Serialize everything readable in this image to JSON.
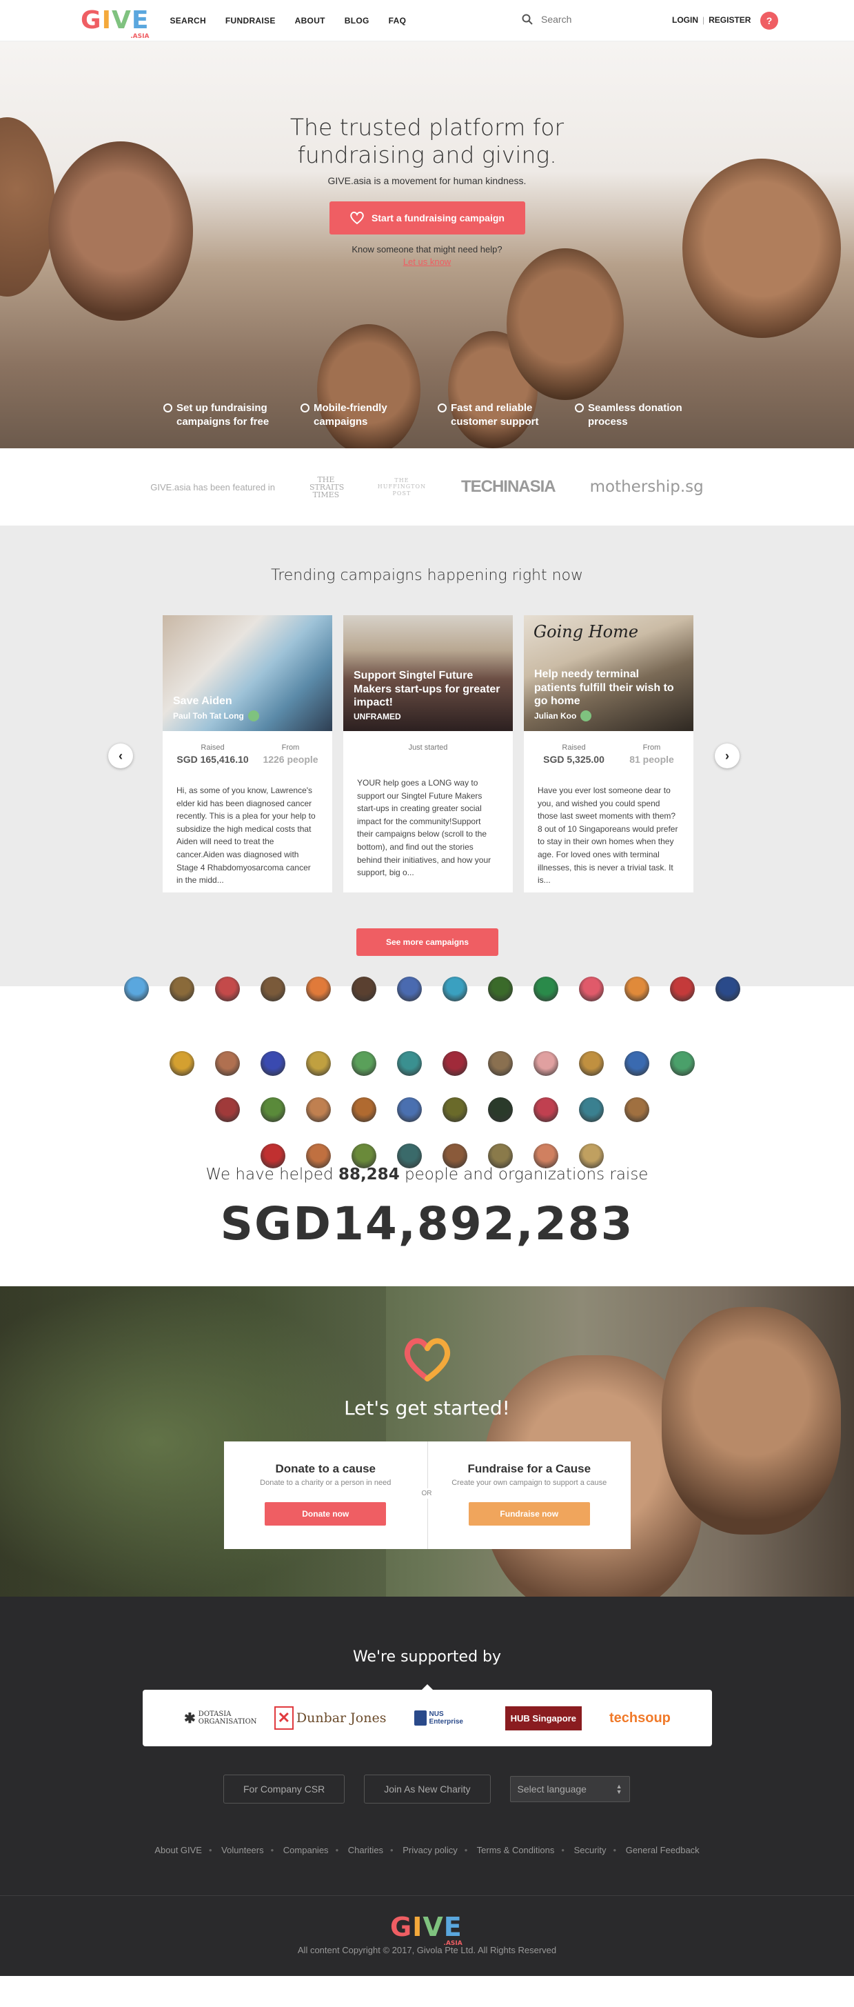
{
  "header": {
    "logo": {
      "g": "G",
      "i": "I",
      "v": "V",
      "e": "E",
      "asia": ".ASIA"
    },
    "nav": [
      "SEARCH",
      "FUNDRAISE",
      "ABOUT",
      "BLOG",
      "FAQ"
    ],
    "search_placeholder": "Search",
    "login": "LOGIN",
    "sep": "|",
    "register": "REGISTER",
    "help": "?"
  },
  "hero": {
    "title_line1": "The trusted platform for",
    "title_line2": "fundraising and giving.",
    "subtitle": "GIVE.asia is a movement for human kindness.",
    "cta": "Start a fundraising campaign",
    "know": "Know someone that might need help?",
    "letus": "Let us know",
    "features": [
      {
        "line1": "Set up fundraising",
        "line2": "campaigns for free"
      },
      {
        "line1": "Mobile-friendly",
        "line2": "campaigns"
      },
      {
        "line1": "Fast and reliable",
        "line2": "customer support"
      },
      {
        "line1": "Seamless donation",
        "line2": "process"
      }
    ]
  },
  "press": {
    "featured": "GIVE.asia has been featured in",
    "straits": "THE STRAITS TIMES",
    "huffington": "THE HUFFINGTON POST",
    "techinasia": "TECHINASIA",
    "mothership": "mothership.sg"
  },
  "trending": {
    "title": "Trending campaigns happening right now",
    "cards": [
      {
        "title": "Save Aiden",
        "owner": "Paul Toh Tat Long",
        "raised_label": "Raised",
        "raised": "SGD 165,416.10",
        "from_label": "From",
        "from": "1226 people",
        "desc": "Hi, as some of you know, Lawrence's elder kid has been diagnosed cancer recently.  This is a plea for your help to subsidize the high medical costs that Aiden will need to treat the cancer.Aiden was diagnosed with Stage 4 Rhabdomyosarcoma cancer in the midd..."
      },
      {
        "title": "Support Singtel Future Makers start-ups for greater impact!",
        "owner": "UNFRAMED",
        "status": "Just started",
        "desc": "YOUR help goes a LONG way to support our Singtel Future Makers start-ups in creating greater social impact for the community!Support their campaigns below (scroll to the bottom), and find out the stories behind their initiatives, and how your support, big o..."
      },
      {
        "title": "Help needy terminal patients fulfill their wish to go home",
        "owner": "Julian Koo",
        "raised_label": "Raised",
        "raised": "SGD 5,325.00",
        "from_label": "From",
        "from": "81 people",
        "desc": "Have you ever lost someone dear to you, and wished you could spend those last sweet moments with them? 8 out of 10 Singaporeans would prefer to stay in their own homes when they age. For loved ones with terminal illnesses, this is never a trivial task. It is..."
      }
    ],
    "going_home": "Going Home",
    "prev": "‹",
    "next": "›",
    "more": "See more campaigns"
  },
  "helped": {
    "pre": "We have helped ",
    "count": "88,284",
    "post": " people and organizations raise",
    "amount": "SGD14,892,283"
  },
  "started": {
    "title": "Let's get started!",
    "donate_title": "Donate to a cause",
    "donate_sub": "Donate to a charity or a person in need",
    "donate_btn": "Donate now",
    "or": "OR",
    "fund_title": "Fundraise for a Cause",
    "fund_sub": "Create your own campaign to support a cause",
    "fund_btn": "Fundraise now"
  },
  "footer": {
    "supported_title": "We're supported by",
    "supporters": [
      "DOTASIA ORGANISATION",
      "Dunbar Jones",
      "NUS Enterprise",
      "HUB Singapore",
      "techsoup"
    ],
    "csr": "For Company CSR",
    "charity": "Join As New Charity",
    "language": "Select language",
    "links": [
      "About GIVE",
      "Volunteers",
      "Companies",
      "Charities",
      "Privacy policy",
      "Terms & Conditions",
      "Security",
      "General Feedback"
    ],
    "copyright": "All content Copyright © 2017, Givola Pte Ltd. All Rights Reserved"
  },
  "colors": {
    "brand_red": "#ef5e63",
    "orange": "#f4a93b",
    "green": "#7fc27f",
    "blue": "#5aa7de",
    "footer_bg": "#2a2a2c"
  }
}
